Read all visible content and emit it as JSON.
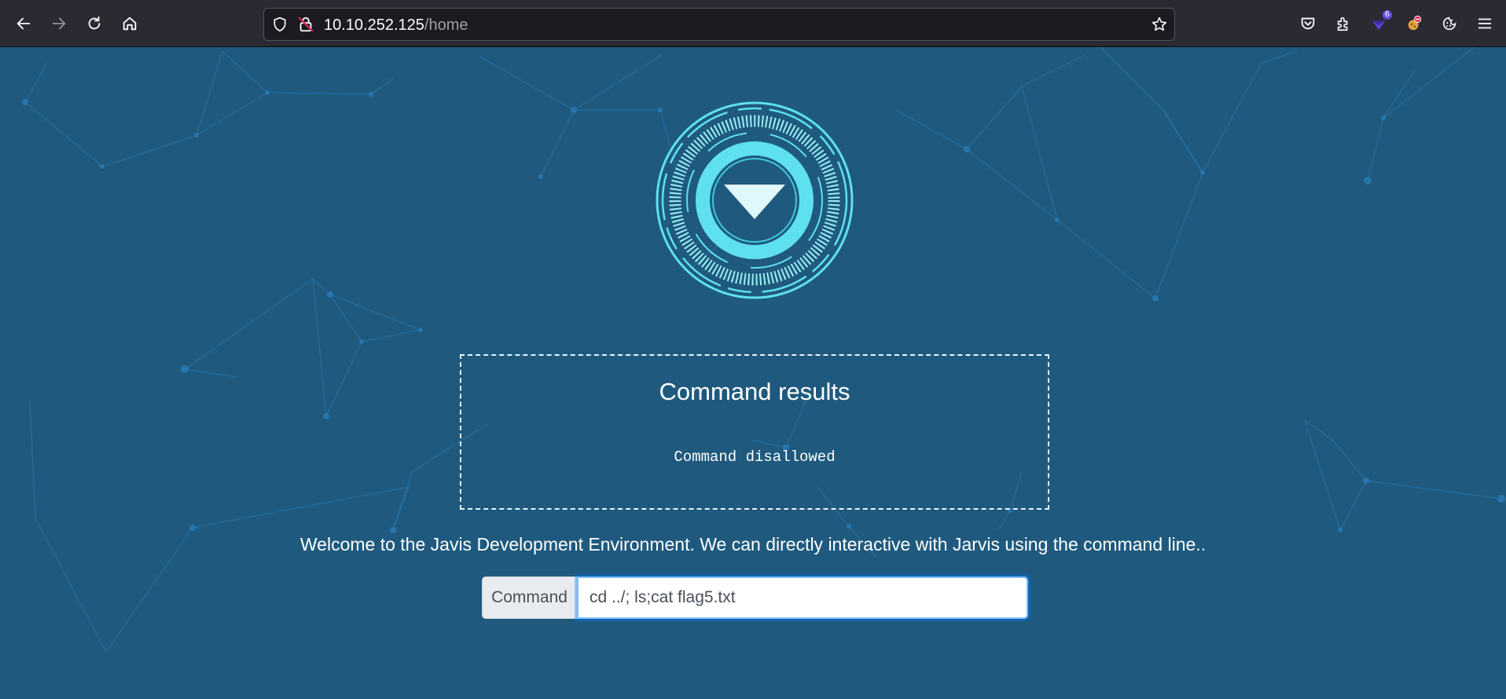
{
  "browser": {
    "url_host": "10.10.252.125",
    "url_path": "/home",
    "extension_badge": "6",
    "icons": [
      "back-icon",
      "forward-icon",
      "reload-icon",
      "home-icon",
      "shield-icon",
      "insecure-lock-icon",
      "bookmark-star-icon",
      "pocket-icon",
      "extensions-icon",
      "foxyproxy-icon",
      "cookie-editor-icon",
      "cookie-icon",
      "menu-icon"
    ]
  },
  "page": {
    "results_title": "Command results",
    "results_output": "Command disallowed",
    "welcome_text": "Welcome to the Javis Development Environment. We can directly interactive with Jarvis using the command line..",
    "command_label": "Command",
    "command_value": "cd ../; ls;cat flag5.txt"
  },
  "colors": {
    "page_background": "#1f5a7e",
    "logo_cyan": "#5ee0ee",
    "input_focus": "#80bdff"
  }
}
